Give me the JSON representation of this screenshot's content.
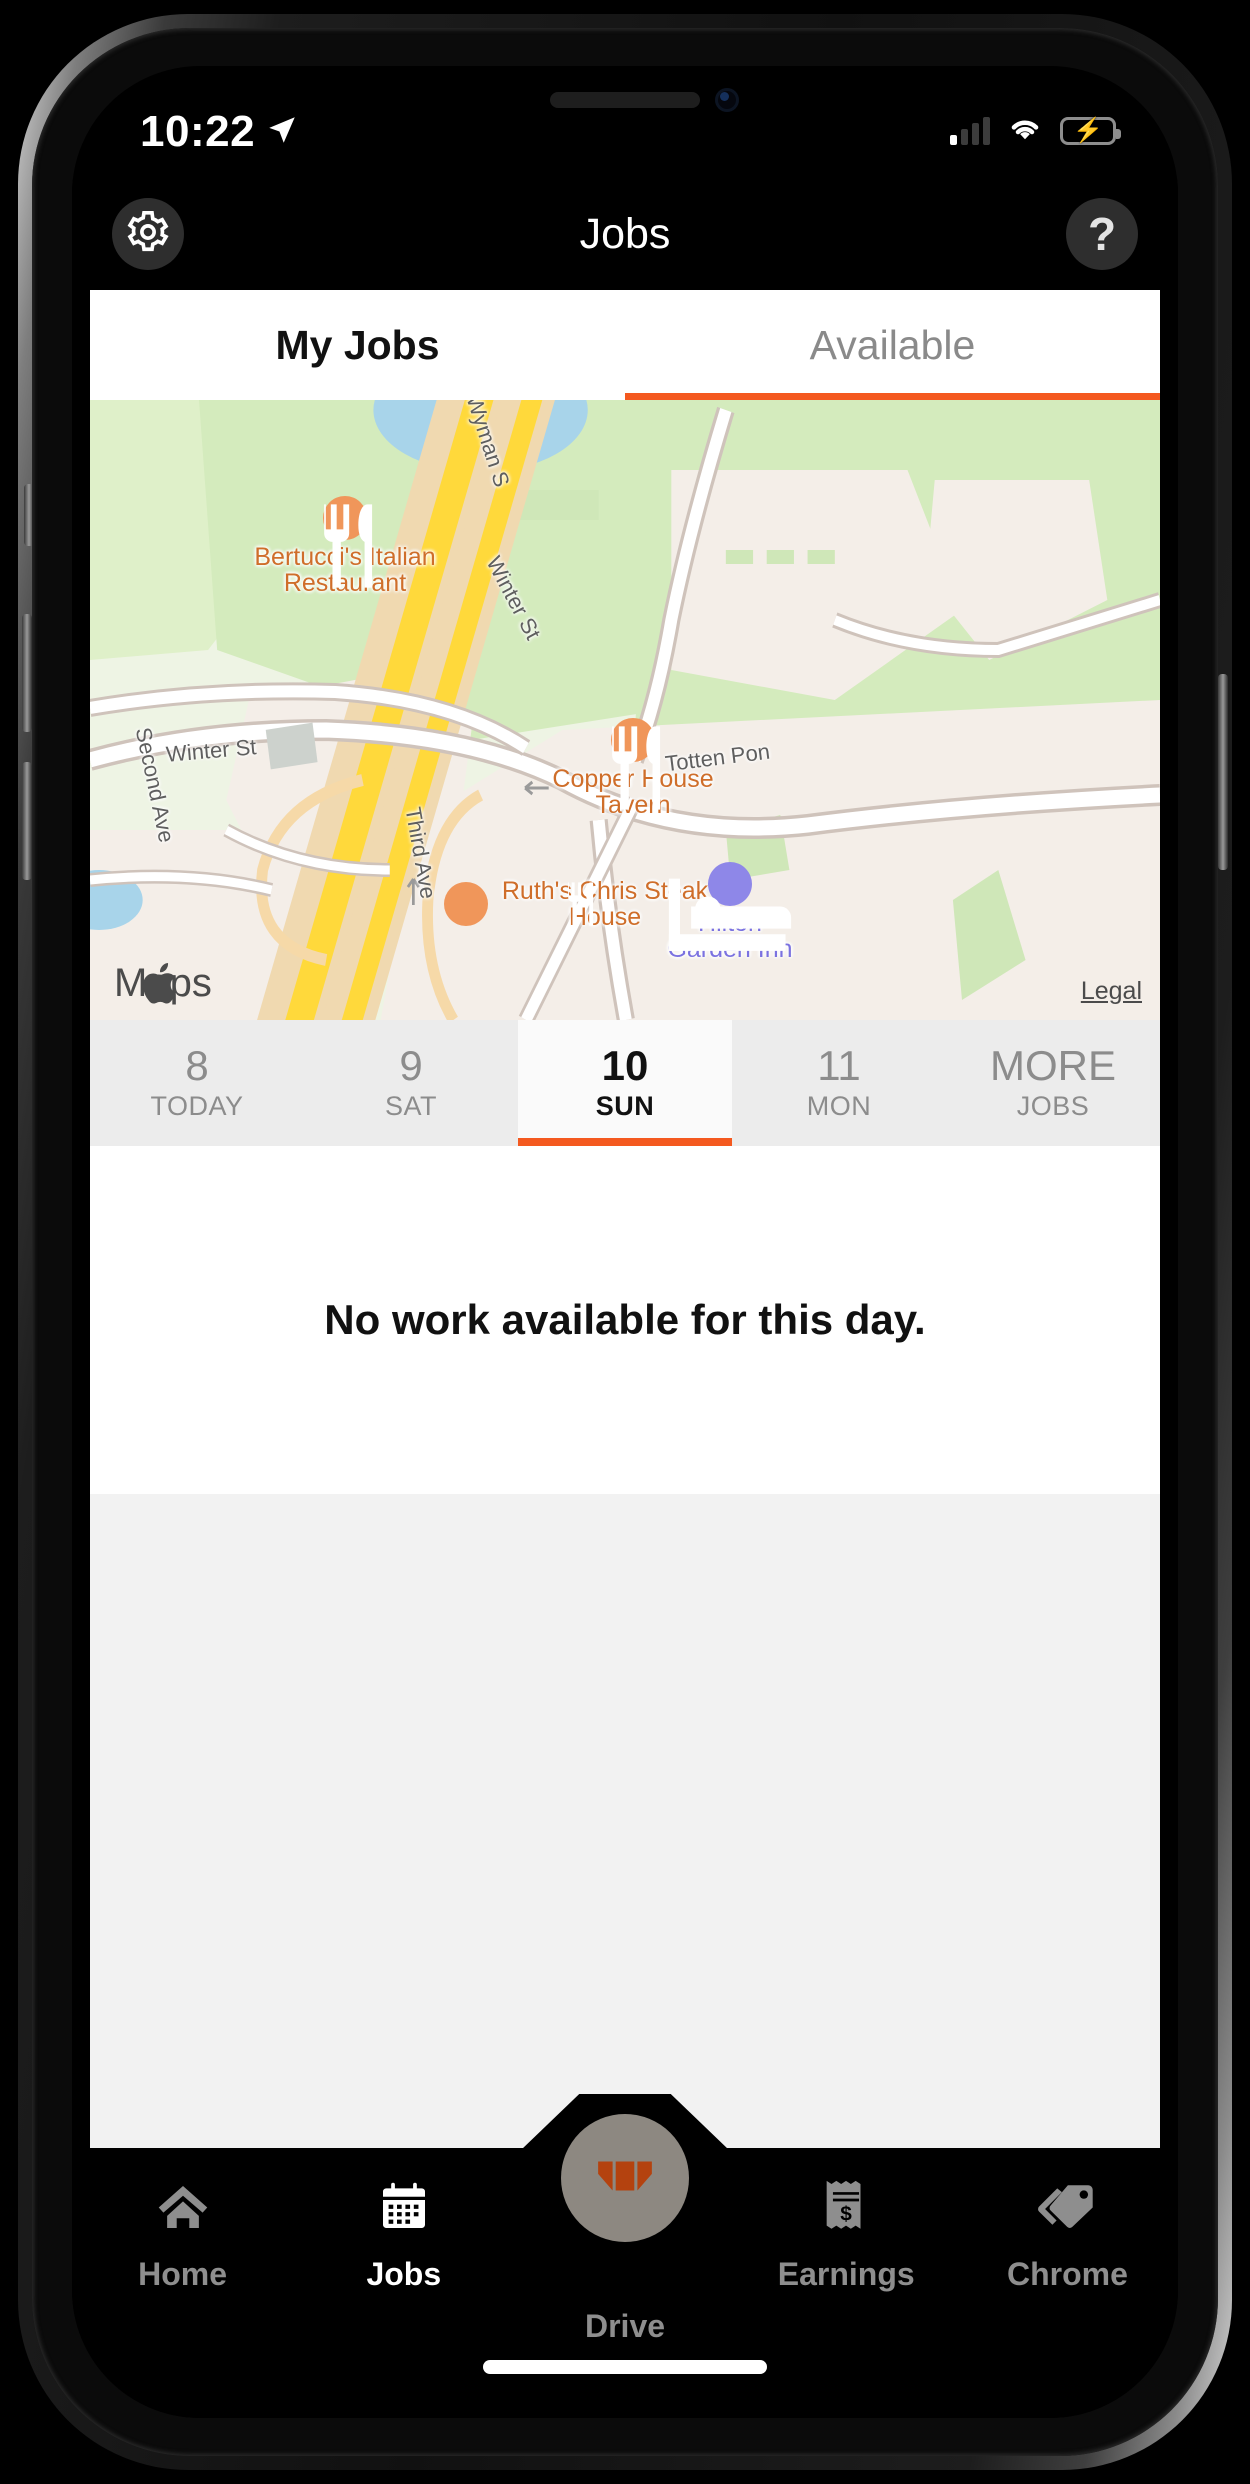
{
  "status_bar": {
    "time": "10:22",
    "location_icon": "location-arrow-icon",
    "signal_icon": "cellular-signal-icon",
    "signal_bars_active": 1,
    "signal_bars_total": 4,
    "wifi_icon": "wifi-icon",
    "battery_icon": "battery-charging-icon",
    "battery_color": "#32d74b"
  },
  "header": {
    "title": "Jobs",
    "settings_icon": "gear-icon",
    "help_label": "?",
    "help_icon": "question-mark-icon"
  },
  "top_tabs": {
    "items": [
      {
        "label": "My Jobs",
        "active": true
      },
      {
        "label": "Available",
        "active": false
      }
    ],
    "underline_color": "#f4591f",
    "underline_on": "Available"
  },
  "map": {
    "provider_label": "Maps",
    "provider_icon": "apple-logo-icon",
    "legal_label": "Legal",
    "home_pin_icon": "home-pin-icon",
    "pois": [
      {
        "name": "Bertucci's Italian Restaurant",
        "type": "restaurant",
        "icon": "fork-knife-icon",
        "color": "#cf6e2a"
      },
      {
        "name": "Copper House Tavern",
        "type": "restaurant",
        "icon": "fork-knife-icon",
        "color": "#cf6e2a"
      },
      {
        "name": "Ruth's Chris Steak House",
        "type": "restaurant",
        "icon": "fork-knife-icon",
        "color": "#cf6e2a"
      },
      {
        "name": "Hilton Garden Inn",
        "type": "hotel",
        "icon": "bed-icon",
        "color": "#7b72e0"
      }
    ],
    "streets": [
      "Winter St",
      "Wyman St",
      "Winter St",
      "Totten Pond",
      "Third Ave",
      "Second Ave"
    ],
    "street_labels": {
      "winter_left": "Winter St",
      "wyman": "Wyman S",
      "winter_right": "Winter St",
      "totten": "Totten Pon",
      "third": "Third Ave",
      "second": "Second Ave"
    },
    "colors": {
      "park": "#cfe7b8",
      "land": "#f2ece6",
      "water": "#a8d4ea",
      "highway": "#ffd93b",
      "road": "#ffffff"
    }
  },
  "date_strip": {
    "days": [
      {
        "num": "8",
        "label": "TODAY",
        "selected": false
      },
      {
        "num": "9",
        "label": "SAT",
        "selected": false
      },
      {
        "num": "10",
        "label": "SUN",
        "selected": true
      },
      {
        "num": "11",
        "label": "MON",
        "selected": false
      },
      {
        "num": "MORE",
        "label": "JOBS",
        "selected": false
      }
    ],
    "selected_color": "#f4591f"
  },
  "message": {
    "text": "No work available for this day."
  },
  "bottom_nav": {
    "items": [
      {
        "label": "Home",
        "icon": "house-icon",
        "active": false
      },
      {
        "label": "Jobs",
        "icon": "calendar-icon",
        "active": true
      },
      {
        "label": "Drive",
        "icon": "drive-logo-icon",
        "active": false
      },
      {
        "label": "Earnings",
        "icon": "receipt-dollar-icon",
        "active": false
      },
      {
        "label": "Chrome",
        "icon": "price-tags-icon",
        "active": false
      }
    ],
    "fab_color": "#8d8881",
    "fab_logo_color": "#b4420f"
  }
}
